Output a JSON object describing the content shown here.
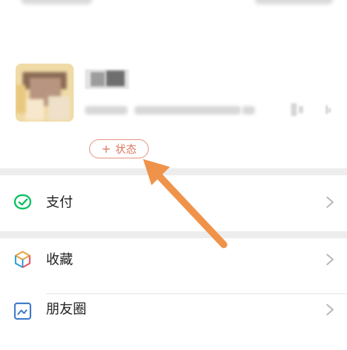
{
  "profile": {
    "status_button": {
      "plus": "+",
      "label": "状态"
    }
  },
  "menu": [
    {
      "id": "pay",
      "label": "支付",
      "icon": "pay-icon",
      "color": "#07c160"
    },
    {
      "id": "favorites",
      "label": "收藏",
      "icon": "favorites-cube-icon",
      "color": "#f0a54a"
    },
    {
      "id": "moments",
      "label": "朋友圈",
      "icon": "moments-icon",
      "color": "#3c79c9"
    }
  ],
  "colors": {
    "accent_status": "#d9765e",
    "arrow": "#f0934a",
    "band": "#ededed"
  }
}
